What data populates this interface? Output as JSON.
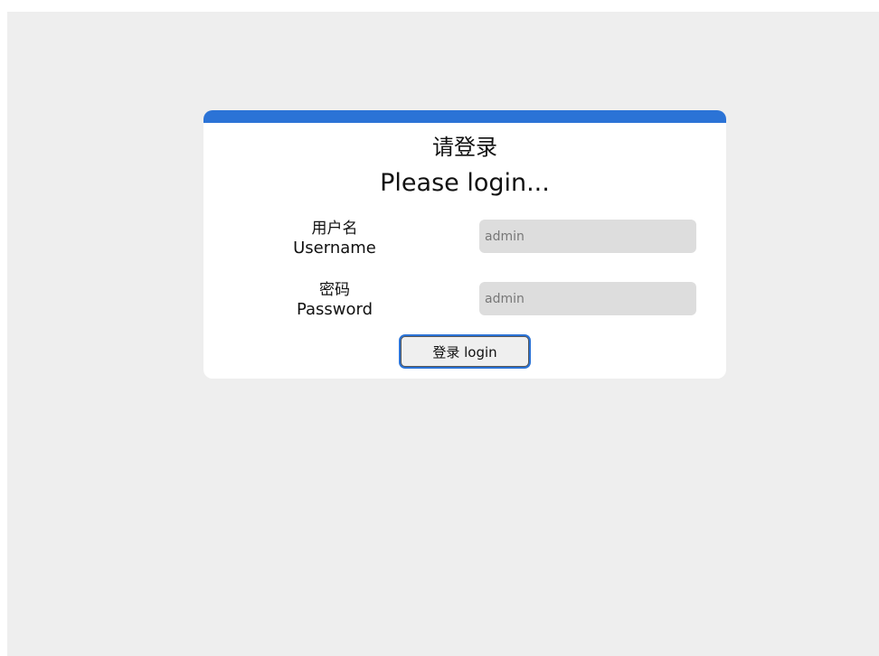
{
  "header": {
    "title_cn": "请登录",
    "title_en": "Please login..."
  },
  "form": {
    "username": {
      "label_cn": "用户名",
      "label_en": "Username",
      "value": "",
      "placeholder": "admin"
    },
    "password": {
      "label_cn": "密码",
      "label_en": "Password",
      "value": "",
      "placeholder": "admin"
    },
    "submit_label": "登录 login"
  },
  "colors": {
    "accent": "#2b73d6",
    "background": "#eeeeee",
    "card": "#ffffff",
    "input_bg": "#dddddd"
  }
}
